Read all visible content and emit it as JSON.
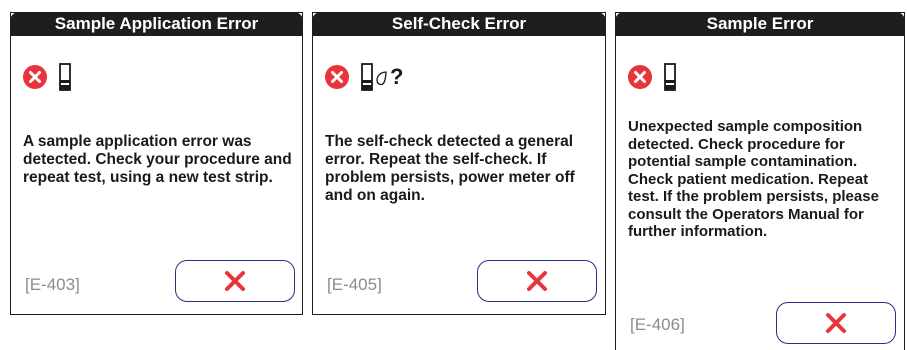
{
  "colors": {
    "error_red": "#e8343a",
    "button_border": "#2a2f86",
    "title_bg": "#1e1e1e"
  },
  "panels": [
    {
      "title": "Sample Application Error",
      "icons": [
        "error-circle-icon",
        "test-strip-icon"
      ],
      "message": "A sample application error was detected. Check your procedure and repeat test, using a new test strip.",
      "code": "[E-403]",
      "button_icon": "close-x-icon"
    },
    {
      "title": "Self-Check Error",
      "icons": [
        "error-circle-icon",
        "test-strip-icon",
        "drop-icon",
        "question-mark-icon"
      ],
      "question_mark": "?",
      "message": "The self-check detected a general error. Repeat the self-check. If problem persists, power meter off and on again.",
      "code": "[E-405]",
      "button_icon": "close-x-icon"
    },
    {
      "title": "Sample Error",
      "icons": [
        "error-circle-icon",
        "test-strip-icon"
      ],
      "message": "Unexpected sample composition detected. Check procedure for potential sample contamination. Check patient medication. Repeat test. If the problem persists, please consult the Operators Manual for further information.",
      "code": "[E-406]",
      "button_icon": "close-x-icon"
    }
  ]
}
